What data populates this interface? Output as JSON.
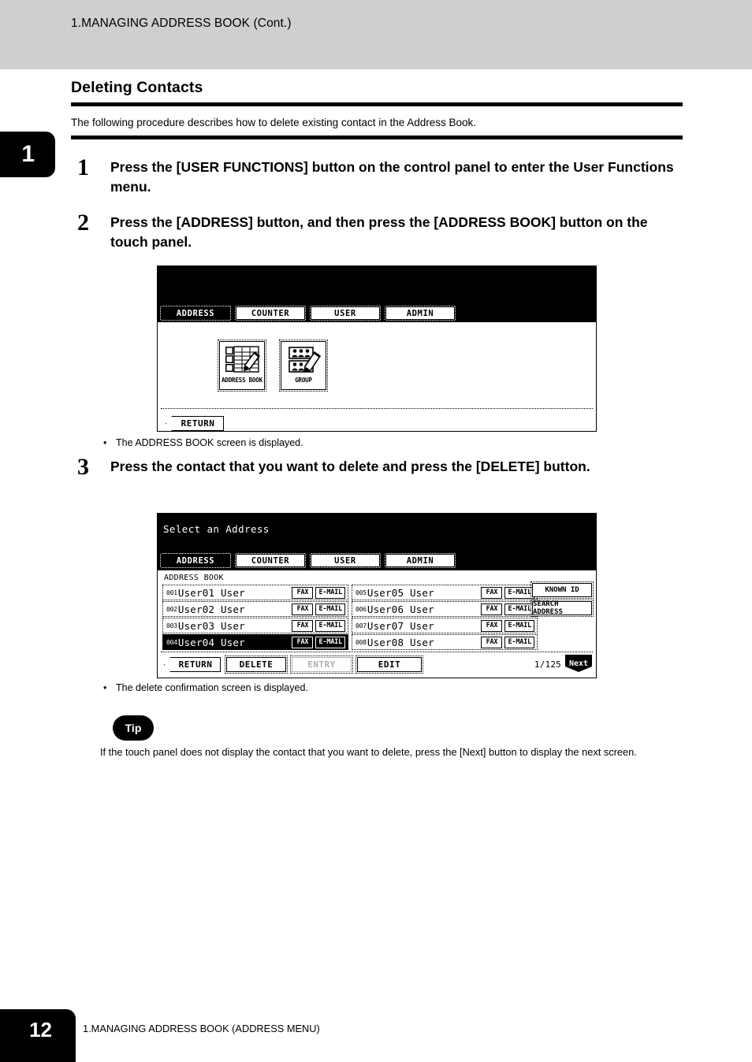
{
  "running_head": "1.MANAGING ADDRESS BOOK (Cont.)",
  "chapter_tab": "1",
  "section": {
    "title": "Deleting Contacts",
    "intro": "The following procedure describes how to delete existing contact in the Address Book."
  },
  "steps": [
    {
      "num": "1",
      "text": "Press the [USER FUNCTIONS] button on the control panel to enter the User Functions menu."
    },
    {
      "num": "2",
      "text": "Press the [ADDRESS] button, and then press the [ADDRESS BOOK] button on the touch panel."
    },
    {
      "num": "3",
      "text": "Press the contact that you want to delete and press the [DELETE] button."
    }
  ],
  "notes": [
    {
      "bullet": "•",
      "text": "The ADDRESS BOOK screen is displayed."
    },
    {
      "bullet": "•",
      "text": "The delete confirmation screen is displayed."
    }
  ],
  "tip": {
    "badge": "Tip",
    "text": "If the touch panel does not display the contact that you want to delete, press the [Next] button to display the next screen."
  },
  "footer": {
    "page_number": "12",
    "text": "1.MANAGING ADDRESS BOOK (ADDRESS MENU)"
  },
  "panel1": {
    "tabs": [
      {
        "label": "ADDRESS",
        "selected": true
      },
      {
        "label": "COUNTER",
        "selected": false
      },
      {
        "label": "USER",
        "selected": false
      },
      {
        "label": "ADMIN",
        "selected": false
      }
    ],
    "icons": [
      {
        "caption": "ADDRESS BOOK",
        "icon": "address-book-icon"
      },
      {
        "caption": "GROUP",
        "icon": "group-icon"
      }
    ],
    "return_label": "RETURN"
  },
  "panel2": {
    "prompt": "Select an Address",
    "tabs": [
      {
        "label": "ADDRESS",
        "selected": true
      },
      {
        "label": "COUNTER",
        "selected": false
      },
      {
        "label": "USER",
        "selected": false
      },
      {
        "label": "ADMIN",
        "selected": false
      }
    ],
    "list_label": "ADDRESS BOOK",
    "tag_fax": "FAX",
    "tag_email": "E-MAIL",
    "contacts_left": [
      {
        "index": "001",
        "name": "User01 User",
        "selected": false
      },
      {
        "index": "002",
        "name": "User02 User",
        "selected": false
      },
      {
        "index": "003",
        "name": "User03 User",
        "selected": false
      },
      {
        "index": "004",
        "name": "User04 User",
        "selected": true
      }
    ],
    "contacts_right": [
      {
        "index": "005",
        "name": "User05 User",
        "selected": false
      },
      {
        "index": "006",
        "name": "User06 User",
        "selected": false
      },
      {
        "index": "007",
        "name": "User07 User",
        "selected": false
      },
      {
        "index": "008",
        "name": "User08 User",
        "selected": false
      }
    ],
    "side_buttons": [
      {
        "label": "KNOWN ID"
      },
      {
        "label": "SEARCH ADDRESS"
      }
    ],
    "bottom_buttons": {
      "return": "RETURN",
      "delete": "DELETE",
      "entry": "ENTRY",
      "edit": "EDIT"
    },
    "page_indicator": "1/125",
    "next_label": "Next"
  }
}
